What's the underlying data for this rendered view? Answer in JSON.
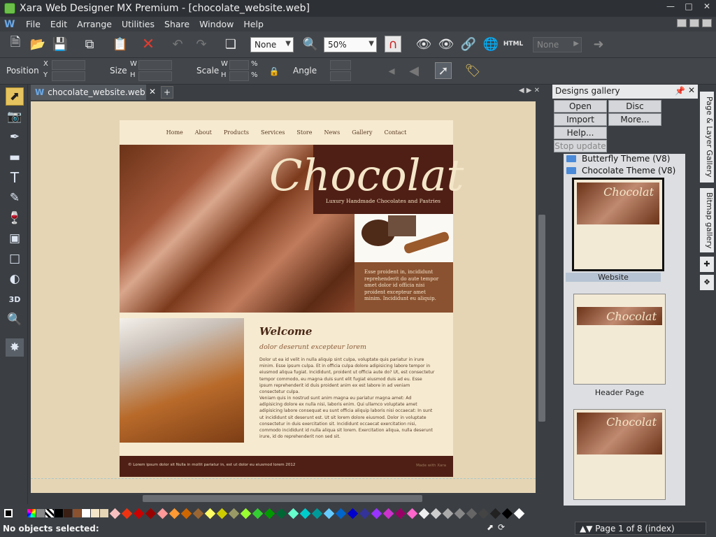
{
  "window": {
    "title": "Xara Web Designer MX Premium - [chocolate_website.web]"
  },
  "menu": [
    "File",
    "Edit",
    "Arrange",
    "Utilities",
    "Share",
    "Window",
    "Help"
  ],
  "toolbar": {
    "quality_combo": "None",
    "zoom_combo": "50%",
    "html_label": "HTML",
    "none_combo2": "None"
  },
  "infobar": {
    "position_label": "Position",
    "x_label": "X",
    "y_label": "Y",
    "size_label": "Size",
    "w_label": "W",
    "h_label": "H",
    "scale_label": "Scale",
    "scale_w": "W",
    "scale_h": "H",
    "percent": "%",
    "angle_label": "Angle"
  },
  "tab": {
    "name": "chocolate_website.web"
  },
  "website": {
    "nav": [
      "Home",
      "About",
      "Products",
      "Services",
      "Store",
      "News",
      "Gallery",
      "Contact"
    ],
    "hero_title": "Chocolat",
    "hero_subtitle": "Luxury Handmade Chocolates and Pastries",
    "box_text": "Esse proident in, incididunt reprehenderit do aute tempor amet dolor id officia nisi proident excepteur amet minim. Incididunt eu aliquip.",
    "welcome_heading": "Welcome",
    "welcome_sub": "dolor deserunt excepteur lorem",
    "para1": "Dolor ut ea id velit in nulla aliquip sint culpa, voluptate quis pariatur in irure minim. Esse ipsum culpa. Et in officia culpa dolore adipisicing labore tempor in eiusmod aliqua fugiat. Incididunt, proident ut officia aute do? Ut, est consectetur tempor commodo, eu magna duis sunt elit fugiat eiusmod duis ad eu. Esse ipsum reprehenderit id duis proident anim ex est labore in ad veniam consectetur culpa.",
    "para2": "Veniam quis in nostrud sunt anim magna eu pariatur magna amet: Ad adipisicing dolore ex nulla nisi, laboris enim. Qui ullamco voluptate amet adipisicing labore consequat eu sunt officia aliquip laboris nisi occaecat: In sunt ut incididunt sit deserunt est. Ut sit lorem dolore eiusmod. Dolor in voluptate consectetur in duis exercitation sit. Incididunt occaecat exercitation nisi, commodo incididunt id nulla aliqua sit lorem. Exercitation aliqua, nulla deserunt irure, id do reprehenderit non sed sit.",
    "footer": "© Lorem ipsum dolor sit Nulla in mollit pariatur in, est ut dolor eu eiusmod lorem 2012",
    "footer_right": "Made with Xara"
  },
  "gallery": {
    "title": "Designs gallery",
    "buttons": {
      "open": "Open",
      "disc": "Disc designs...",
      "import": "Import",
      "more": "More...",
      "help": "Help...",
      "stop": "Stop update"
    },
    "folders": [
      "Butterfly Theme (V8)",
      "Chocolate Theme (V8)"
    ],
    "thumbs": [
      {
        "label": "Website",
        "title": "Chocolat"
      },
      {
        "label": "Header Page",
        "title": "Chocolat"
      },
      {
        "label": "",
        "title": "Chocolat"
      }
    ]
  },
  "side_tabs": {
    "page_layer": "Page & Layer Gallery",
    "bitmap": "Bitmap gallery"
  },
  "status": {
    "message": "No objects selected:",
    "page": "Page 1 of 8 (index)"
  },
  "palette": [
    "#000000",
    "#ffffff",
    "#3a1f14",
    "#8a5230",
    "#f4e6c8",
    "#e5d5b5"
  ],
  "accent": {
    "brand_dark": "#4f1f15",
    "tool_active": "#e5c35f"
  }
}
